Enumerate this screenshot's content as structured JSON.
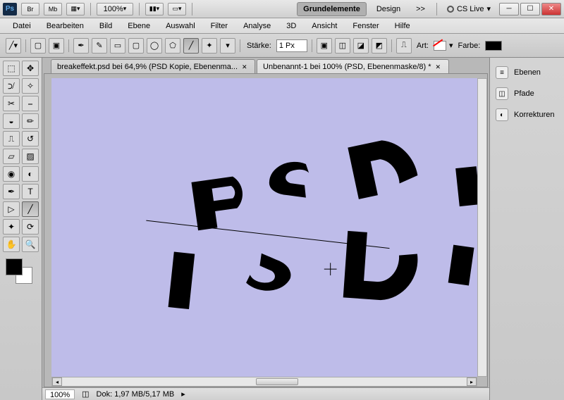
{
  "titlebar": {
    "zoom": "100%",
    "workspaces": {
      "active": "Grundelemente",
      "other": "Design",
      "more": ">>"
    },
    "cslive": "CS Live"
  },
  "menu": [
    "Datei",
    "Bearbeiten",
    "Bild",
    "Ebene",
    "Auswahl",
    "Filter",
    "Analyse",
    "3D",
    "Ansicht",
    "Fenster",
    "Hilfe"
  ],
  "options": {
    "staerke_label": "Stärke:",
    "staerke_value": "1 Px",
    "art_label": "Art:",
    "farbe_label": "Farbe:",
    "farbe_value": "#000000"
  },
  "tabs": [
    {
      "label": "breakeffekt.psd bei 64,9% (PSD Kopie, Ebenenma...",
      "active": false
    },
    {
      "label": "Unbenannt-1 bei 100% (PSD, Ebenenmaske/8) *",
      "active": true
    }
  ],
  "status": {
    "zoom": "100%",
    "doc": "Dok: 1,97 MB/5,17 MB"
  },
  "panels": [
    "Ebenen",
    "Pfade",
    "Korrekturen"
  ],
  "panel_icons": [
    "≡",
    "◫",
    "◐"
  ],
  "colors": {
    "fg": "#000000",
    "bg": "#ffffff",
    "canvas_bg": "#bebce9"
  }
}
